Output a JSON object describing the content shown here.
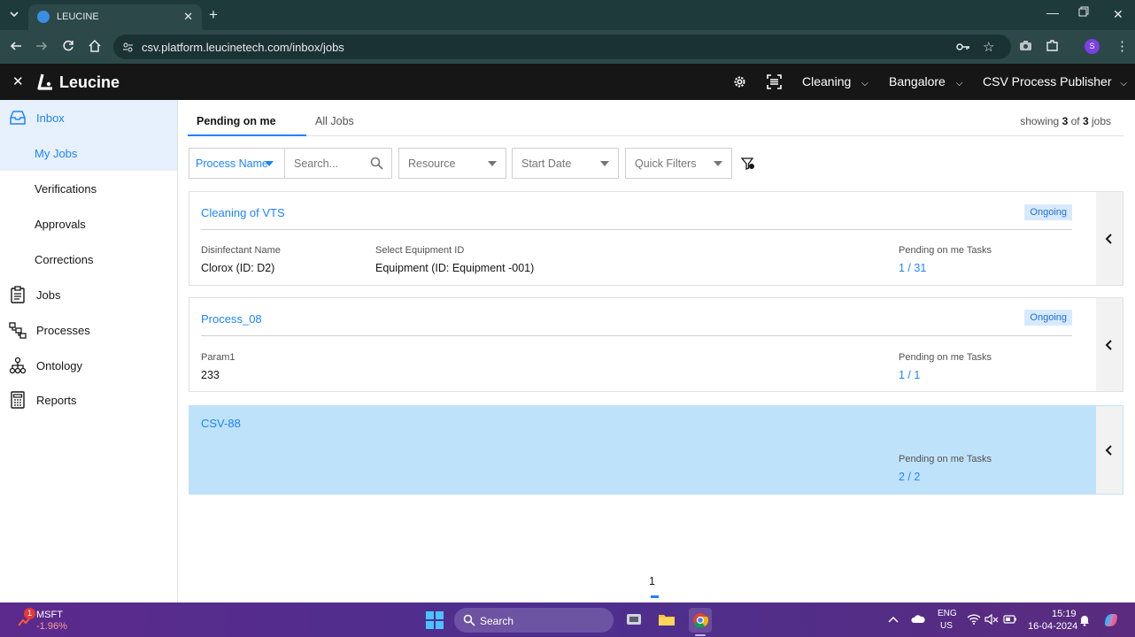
{
  "browser": {
    "tab_title": "LEUCINE",
    "url": "csv.platform.leucinetech.com/inbox/jobs",
    "profile_initial": "S"
  },
  "app": {
    "brand": "Leucine",
    "header_dropdowns": [
      "Cleaning",
      "Bangalore",
      "CSV Process Publisher"
    ]
  },
  "sidebar": {
    "items": [
      {
        "label": "Inbox",
        "icon": "inbox-icon"
      },
      {
        "label": "My Jobs"
      },
      {
        "label": "Verifications"
      },
      {
        "label": "Approvals"
      },
      {
        "label": "Corrections"
      },
      {
        "label": "Jobs",
        "icon": "clipboard-icon"
      },
      {
        "label": "Processes",
        "icon": "flow-icon"
      },
      {
        "label": "Ontology",
        "icon": "hierarchy-icon"
      },
      {
        "label": "Reports",
        "icon": "report-icon"
      }
    ]
  },
  "main": {
    "tabs": [
      "Pending on me",
      "All Jobs"
    ],
    "showing": {
      "prefix": "showing",
      "shown": "3",
      "of": "of",
      "total": "3",
      "suffix": "jobs"
    },
    "filters": {
      "process_name": "Process Name",
      "search_placeholder": "Search...",
      "resource": "Resource",
      "start_date": "Start Date",
      "quick_filters": "Quick Filters"
    },
    "jobs": [
      {
        "title": "Cleaning of VTS",
        "status": "Ongoing",
        "params": [
          {
            "label": "Disinfectant Name",
            "value": "Clorox (ID: D2)"
          },
          {
            "label": "Select Equipment ID",
            "value": "Equipment (ID: Equipment -001)"
          }
        ],
        "pending_label": "Pending on me Tasks",
        "pending_value": "1 / 31"
      },
      {
        "title": "Process_08",
        "status": "Ongoing",
        "params": [
          {
            "label": "Param1",
            "value": "233"
          }
        ],
        "pending_label": "Pending on me Tasks",
        "pending_value": "1 / 1"
      },
      {
        "title": "CSV-88",
        "pending_label": "Pending on me Tasks",
        "pending_value": "2 / 2"
      }
    ],
    "page": "1"
  },
  "taskbar": {
    "stock_name": "MSFT",
    "stock_change": "-1.96%",
    "stock_badge": "1",
    "search": "Search",
    "lang_top": "ENG",
    "lang_bottom": "US",
    "time": "15:19",
    "date": "16-04-2024"
  }
}
